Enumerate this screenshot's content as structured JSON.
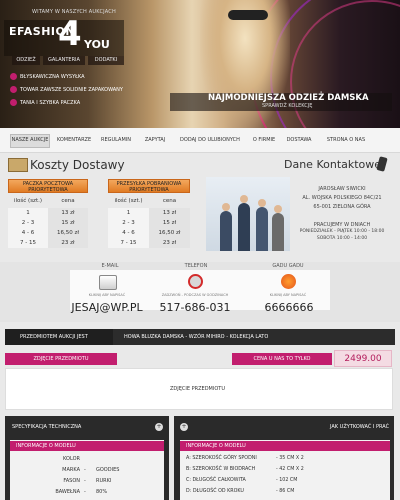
{
  "header": {
    "welcome": "WITAMY W NASZYCH AUKCJACH",
    "logo_left": "EFASHION",
    "logo_num": "4",
    "logo_right": "YOU",
    "nav": [
      "ODZIEŻ",
      "GALANTERIA",
      "DODATKI"
    ],
    "features": [
      "BŁYSKAWICZNA WYSYŁKA",
      "TOWAR ZAWSZE SOLIDNIE ZAPAKOWANY",
      "TANIA I SZYBKA PACZKA"
    ],
    "slogan": "NAJMODNIEJSZA ODZIEŻ DAMSKA",
    "slogan_sub": "SPRAWDŹ KOLEKCJĘ"
  },
  "menu": [
    "NASZE AUKCJE",
    "KOMENTARZE",
    "REGULAMIN",
    "ZAPYTAJ",
    "DODAJ DO ULUBIONYCH",
    "O FIRMIE",
    "DOSTAWA",
    "STRONA O NAS"
  ],
  "shipping": {
    "title": "Koszty Dostawy",
    "left_header": "PACZKA POCZTOWA\nPRIORYTETOWA",
    "right_header": "PRZESYŁKA POBRANIOWA\nPRIORYTETOWA",
    "col_qty": "ilość (szt.)",
    "col_price": "cena",
    "left_rows": [
      [
        "1",
        "13 zł"
      ],
      [
        "2 - 3",
        "15 zł"
      ],
      [
        "4 - 6",
        "16,50 zł"
      ],
      [
        "7 - 15",
        "23 zł"
      ]
    ],
    "right_rows": [
      [
        "1",
        "13 zł"
      ],
      [
        "2 - 3",
        "15 zł"
      ],
      [
        "4 - 6",
        "16,50 zł"
      ],
      [
        "7 - 15",
        "23 zł"
      ]
    ]
  },
  "contact": {
    "title": "Dane Kontaktowe",
    "name": "JAROSŁAW SIWICKI",
    "street": "AL. WOJSKA POLSKIEGO 84C/21",
    "city": "65-001 ZIELONA GÓRA",
    "hours_title": "PRACUJEMY W DNIACH",
    "hours1": "PONIEDZIAŁEK - PIĄTEK 10:00 - 18:00",
    "hours2": "SOBOTA 10:00 - 14:00",
    "email_label": "E-MAIL",
    "email_small": "KLIKNIJ ABY NAPISAĆ",
    "email": "JESAJ@WP.PL",
    "phone_label": "TELEFON",
    "phone_small": "ZADZWOŃ - PODCZAS W GODZINACH",
    "phone": "517-686-031",
    "gg_label": "GADU GADU",
    "gg_small": "KLIKNIJ ABY NAPISAĆ",
    "gg": "6666666"
  },
  "product": {
    "label": "PRZEDMIOTEM AUKCJI JEST",
    "name": "HOWA BLUZKA DAMSKA - WZÓR MIHIRO - KOLEKCJA LATO",
    "photos_button": "ZDJĘCIE PRZEDMIOTU",
    "price_label": "CENA U NAS TO TYLKO",
    "price": "2499.00 PLN",
    "photo_placeholder": "ZDJĘCIE PRZEDMIOTU"
  },
  "spec": {
    "title": "SPECYFIKACJA TECHNICZNA",
    "info": "INFORMACJE O MODELU",
    "rows": [
      [
        "KOLOR",
        ""
      ],
      [
        "MARKA",
        "GOODIES"
      ],
      [
        "FASON",
        "RURKI"
      ],
      [
        "BAWEŁNA",
        "80%"
      ],
      [
        "",
        ""
      ]
    ]
  },
  "sizes": {
    "title": "JAK UŻYTKOWAĆ I PRAĆ",
    "info": "INFORMACJE O MODELU",
    "rows": [
      [
        "A: SZEROKOŚĆ GÓRY SPODNI",
        "- 35 CM X 2"
      ],
      [
        "B: SZEROKOŚĆ W BIODRACH",
        "- 42 CM X 2"
      ],
      [
        "C: DŁUGOŚĆ CAŁKOWITA",
        "- 102 CM"
      ],
      [
        "D: DŁUGOŚĆ OD KROKU",
        "- 86 CM"
      ]
    ]
  },
  "colors": {
    "accent": "#c21e6e",
    "orange": "#e07b24",
    "dark": "#2a2a2a"
  }
}
